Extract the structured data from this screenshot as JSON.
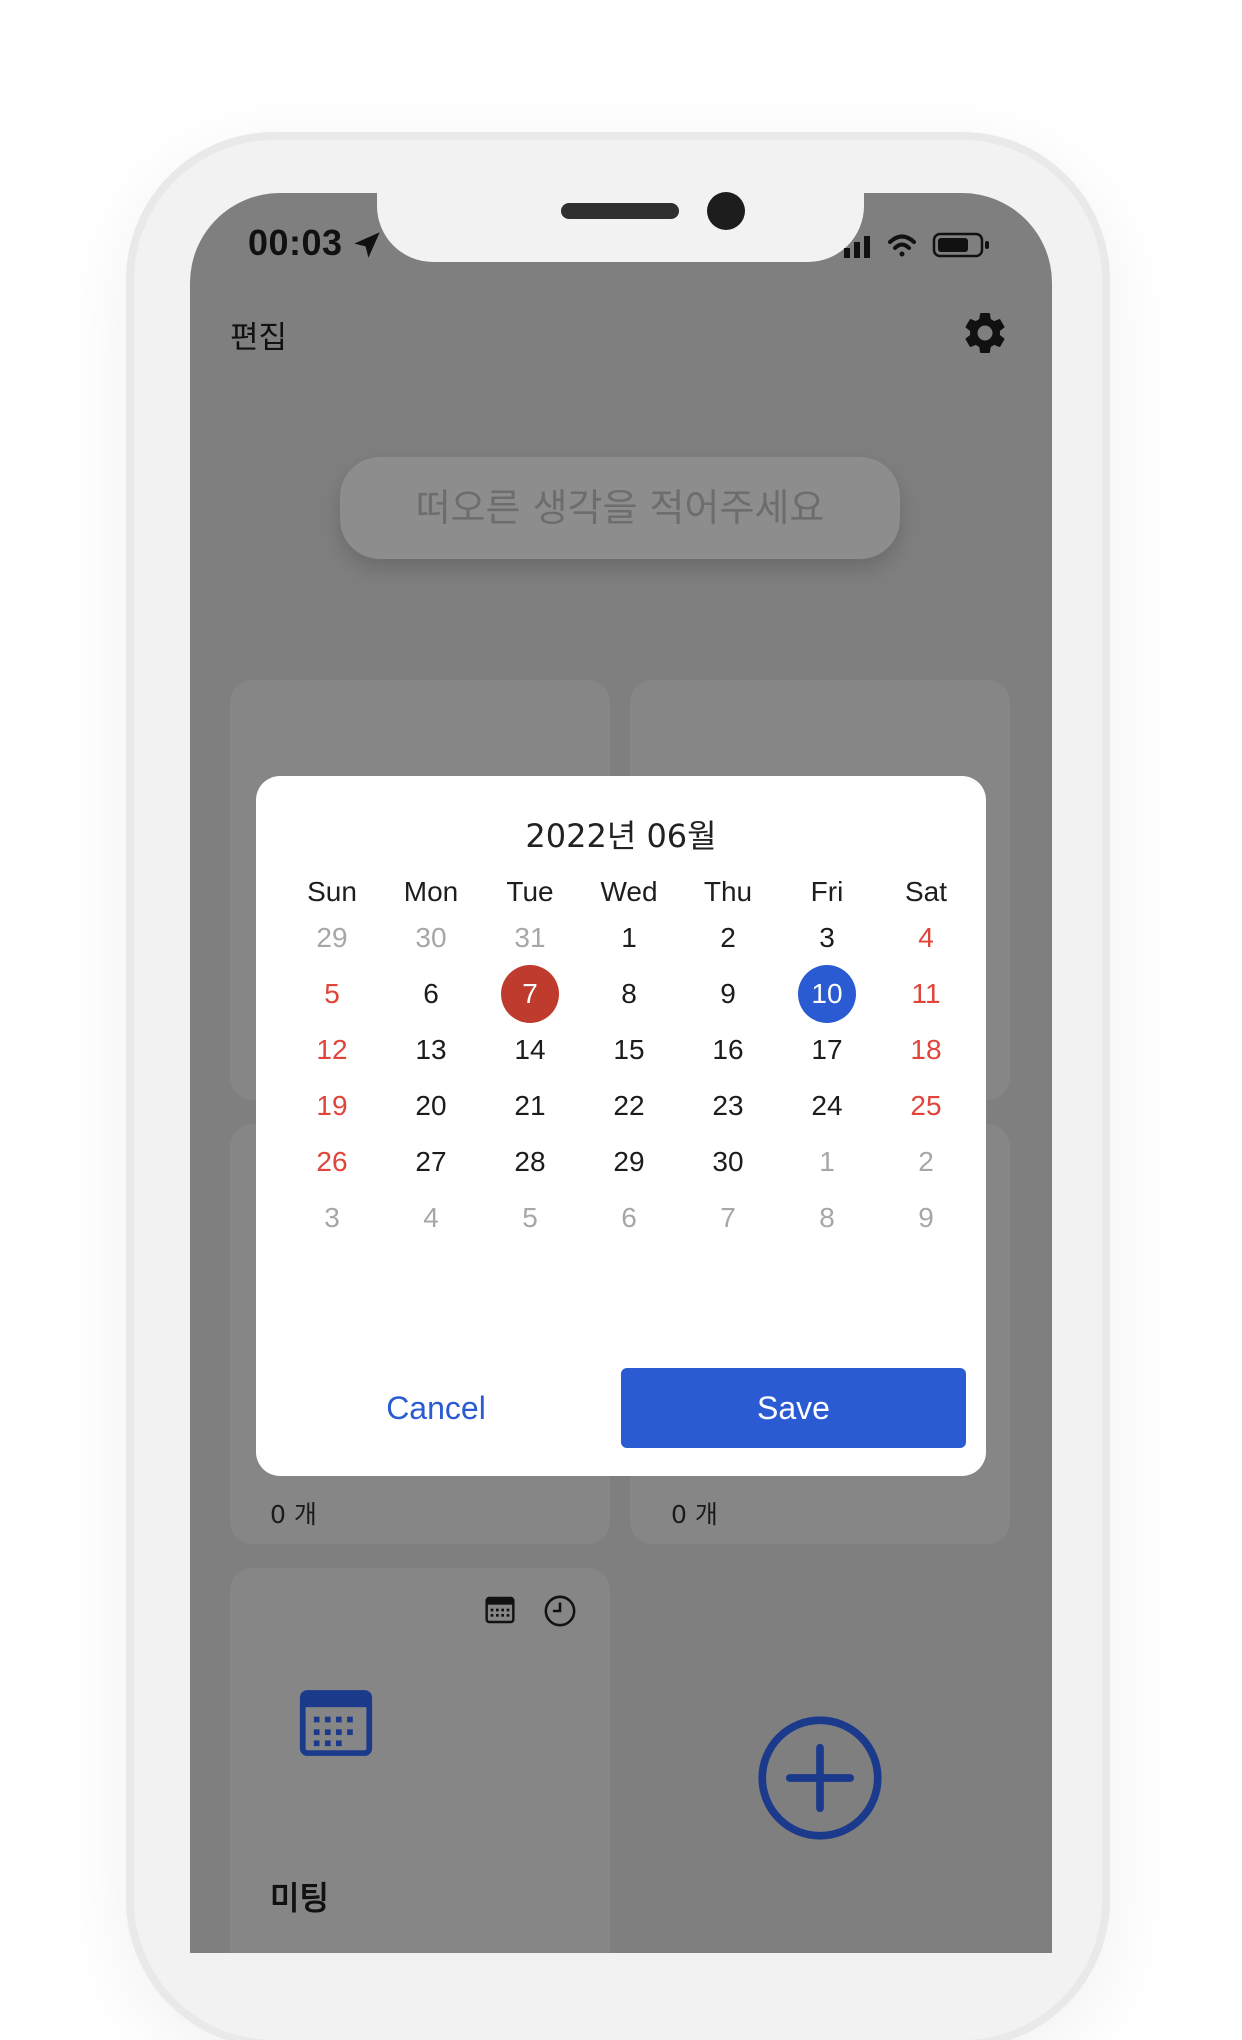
{
  "status_bar": {
    "time": "00:03"
  },
  "header": {
    "edit_label": "편집"
  },
  "search": {
    "placeholder": "떠오른 생각을 적어주세요"
  },
  "cards": [
    {
      "count": "0 개"
    },
    {
      "count": "0 개"
    },
    {
      "title": "미팅"
    }
  ],
  "calendar": {
    "month_title": "2022년 06월",
    "weekdays": [
      "Sun",
      "Mon",
      "Tue",
      "Wed",
      "Thu",
      "Fri",
      "Sat"
    ],
    "weeks": [
      [
        "29",
        "30",
        "31",
        "1",
        "2",
        "3",
        "4"
      ],
      [
        "5",
        "6",
        "7",
        "8",
        "9",
        "10",
        "11"
      ],
      [
        "12",
        "13",
        "14",
        "15",
        "16",
        "17",
        "18"
      ],
      [
        "19",
        "20",
        "21",
        "22",
        "23",
        "24",
        "25"
      ],
      [
        "26",
        "27",
        "28",
        "29",
        "30",
        "1",
        "2"
      ],
      [
        "3",
        "4",
        "5",
        "6",
        "7",
        "8",
        "9"
      ]
    ],
    "today": "7",
    "selected": "10",
    "cancel_label": "Cancel",
    "save_label": "Save"
  },
  "colors": {
    "accent": "#2a5bd2",
    "today": "#be3b2e",
    "weekend": "#e0443a",
    "muted": "#a7a7a7",
    "overlay": "#7f7f7f",
    "icon_blue": "#1b3a8c"
  },
  "icons": [
    "location-arrow-icon",
    "signal-icon",
    "wifi-icon",
    "battery-icon",
    "gear-icon",
    "calendar-small-icon",
    "clock-icon",
    "calendar-icon",
    "add-circle-icon"
  ]
}
